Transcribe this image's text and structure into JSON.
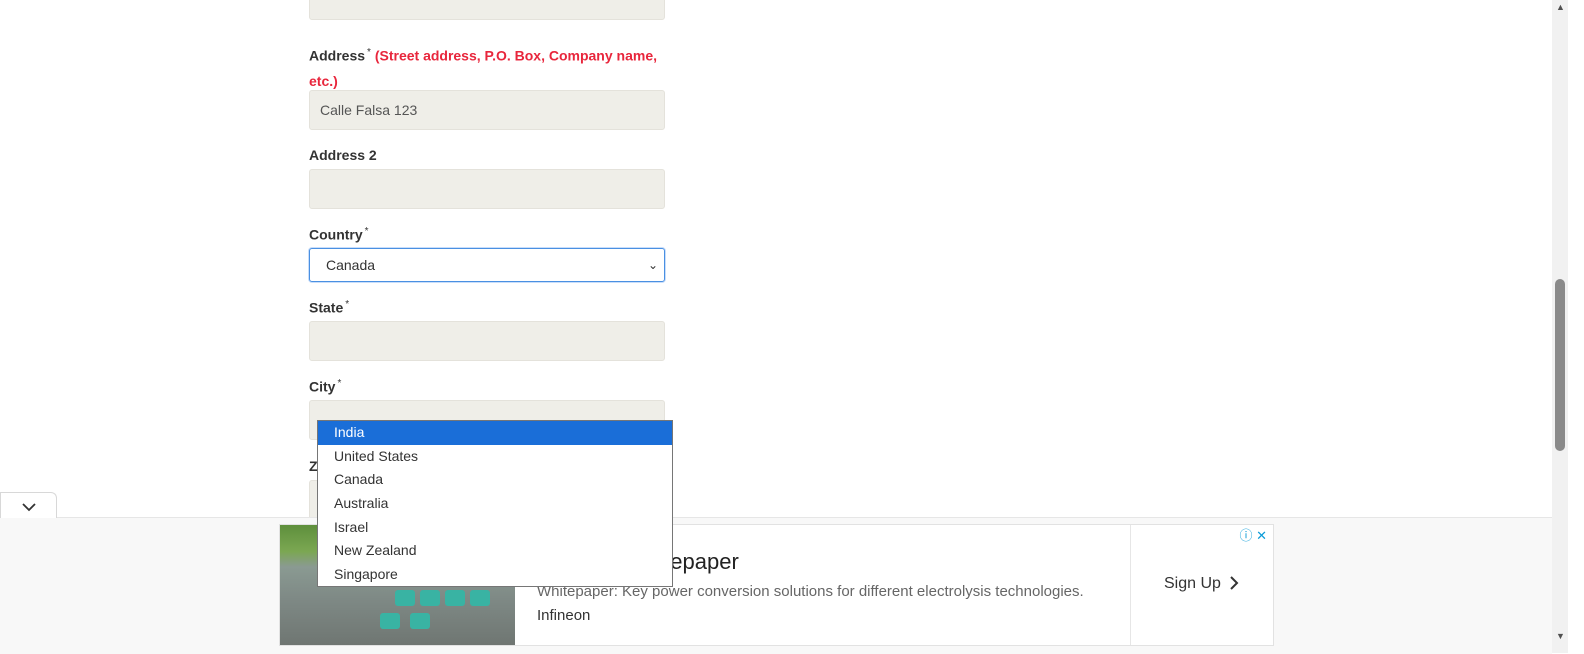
{
  "form": {
    "address_label": "Address",
    "address_hint": "(Street address, P.O. Box, Company name, etc.)",
    "address_value": "Calle Falsa 123",
    "address2_label": "Address 2",
    "country_label": "Country",
    "country_value": "Canada",
    "state_label": "State",
    "city_label": "City",
    "zip_label_partial": "Z",
    "required_mark": "*"
  },
  "country_dropdown": {
    "options": [
      "India",
      "United States",
      "Canada",
      "Australia",
      "Israel",
      "New Zealand",
      "Singapore"
    ],
    "highlighted": "India"
  },
  "ad": {
    "title": "nversion Whitepaper",
    "description": "Whitepaper: Key power conversion solutions for different electrolysis technologies.",
    "brand": "Infineon",
    "cta": "Sign Up",
    "info_icon": "info-icon",
    "close_icon": "close-icon"
  },
  "colors": {
    "hint_red": "#e8263c",
    "highlight_blue": "#1a6ed8",
    "field_bg": "#efeee8"
  }
}
